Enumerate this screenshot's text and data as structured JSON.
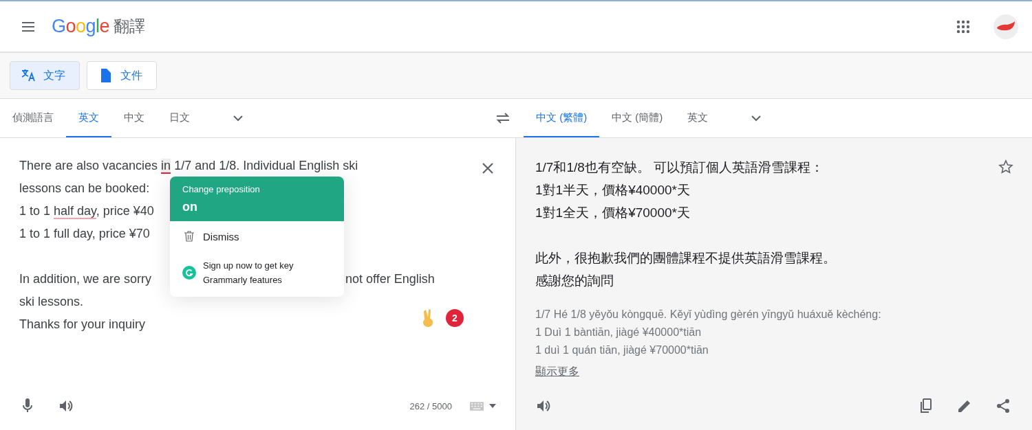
{
  "header": {
    "logo": "Google",
    "product": "翻譯"
  },
  "mode_tabs": [
    {
      "kind": "text",
      "label": "文字",
      "selected": true
    },
    {
      "kind": "document",
      "label": "文件",
      "selected": false
    }
  ],
  "source_languages": [
    {
      "label": "偵測語言",
      "selected": false
    },
    {
      "label": "英文",
      "selected": true
    },
    {
      "label": "中文",
      "selected": false
    },
    {
      "label": "日文",
      "selected": false
    }
  ],
  "target_languages": [
    {
      "label": "中文 (繁體)",
      "selected": true
    },
    {
      "label": "中文 (簡體)",
      "selected": false
    },
    {
      "label": "英文",
      "selected": false
    }
  ],
  "source_text": [
    {
      "lines": [
        {
          "kind": "full",
          "segments": [
            {
              "text": "There are also vacancies ",
              "kind": "plain"
            },
            {
              "text": "in",
              "kind": "error"
            },
            {
              "text": " 1/7 and 1/8. Individual English ski",
              "kind": "plain"
            }
          ]
        },
        {
          "kind": "split",
          "segments": [
            {
              "text": "lessons can be booked:",
              "kind": "plain"
            }
          ]
        },
        {
          "kind": "split",
          "segments": [
            {
              "text": "1 to 1 ",
              "kind": "plain"
            },
            {
              "text": "half day",
              "kind": "suggestion"
            },
            {
              "text": ", price ¥40",
              "kind": "plain"
            }
          ]
        },
        {
          "kind": "split",
          "segments": [
            {
              "text": "1 to 1 full day, price ¥70",
              "kind": "plain"
            }
          ]
        }
      ]
    },
    {
      "lines": [
        {
          "kind": "split",
          "segments": [
            {
              "text": "In addition, we are sorry",
              "kind": "plain"
            }
          ],
          "right": "not offer English"
        },
        {
          "kind": "full",
          "segments": [
            {
              "text": "ski lessons.",
              "kind": "plain"
            }
          ]
        },
        {
          "kind": "full",
          "segments": [
            {
              "text": "Thanks for your inquiry",
              "kind": "plain"
            }
          ]
        }
      ]
    }
  ],
  "grammar_popup": {
    "title": "Change preposition",
    "suggestion": "on",
    "dismiss": "Dismiss",
    "promo": "Sign up now to get key Grammarly features"
  },
  "grammar_badge": {
    "count": "2"
  },
  "char_count": "262 / 5000",
  "translation": [
    {
      "lines": [
        "1/7和1/8也有空缺。 可以預訂個人英語滑雪課程：",
        "1對1半天，價格¥40000*天",
        "1對1全天，價格¥70000*天"
      ]
    },
    {
      "lines": [
        "此外，很抱歉我們的團體課程不提供英語滑雪課程。",
        "感謝您的詢問"
      ]
    }
  ],
  "romanization": [
    "1/7 Hé 1/8 yěyǒu kòngquē. Kěyǐ yùdìng gèrén yīngyǔ huáxuě kèchéng:",
    "1 Duì 1 bàntiān, jiàgé ¥40000*tiān",
    "1 duì 1 quán tiān, jiàgé ¥70000*tiān"
  ],
  "show_more": "顯示更多"
}
